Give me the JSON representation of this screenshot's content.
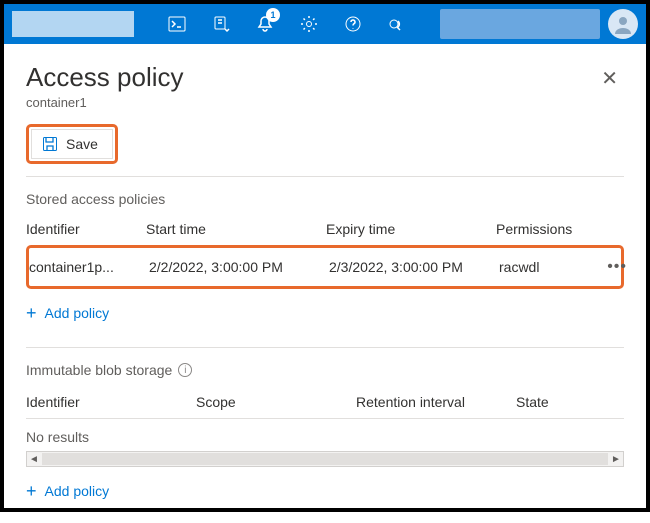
{
  "topbar": {
    "notification_count": "1"
  },
  "panel": {
    "title": "Access policy",
    "subtitle": "container1",
    "save_label": "Save"
  },
  "stored": {
    "section_label": "Stored access policies",
    "col_identifier": "Identifier",
    "col_start": "Start time",
    "col_expiry": "Expiry time",
    "col_permissions": "Permissions",
    "row": {
      "identifier": "container1p...",
      "start": "2/2/2022, 3:00:00 PM",
      "expiry": "2/3/2022, 3:00:00 PM",
      "permissions": "racwdl"
    },
    "add_label": "Add policy"
  },
  "immutable": {
    "section_label": "Immutable blob storage",
    "col_identifier": "Identifier",
    "col_scope": "Scope",
    "col_retention": "Retention interval",
    "col_state": "State",
    "no_results": "No results",
    "add_label": "Add policy"
  }
}
